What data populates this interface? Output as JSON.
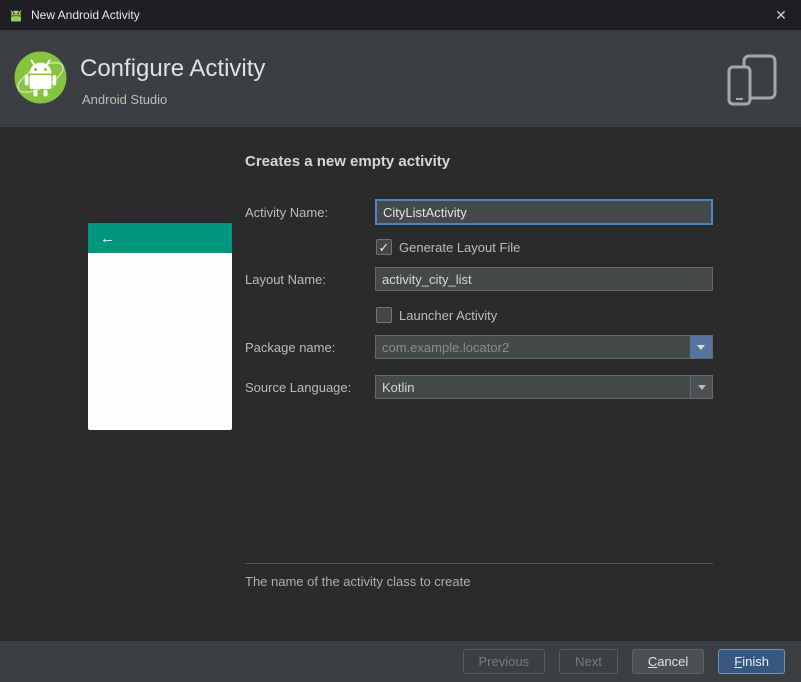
{
  "titlebar": {
    "title": "New Android Activity",
    "close_glyph": "✕"
  },
  "header": {
    "title": "Configure Activity",
    "subtitle": "Android Studio"
  },
  "main": {
    "heading": "Creates a new empty activity",
    "preview": {
      "back_arrow": "←"
    },
    "fields": {
      "activity_name": {
        "label": "Activity Name:",
        "value": "CityListActivity"
      },
      "generate_layout_file": {
        "label": "Generate Layout File",
        "checked": true,
        "check_glyph": "✓"
      },
      "layout_name": {
        "label": "Layout Name:",
        "value": "activity_city_list"
      },
      "launcher_activity": {
        "label": "Launcher Activity",
        "checked": false,
        "check_glyph": ""
      },
      "package_name": {
        "label": "Package name:",
        "value": "com.example.locator2"
      },
      "source_language": {
        "label": "Source Language:",
        "value": "Kotlin"
      }
    },
    "hint": "The name of the activity class to create"
  },
  "footer": {
    "previous": "Previous",
    "next": "Next",
    "cancel": {
      "initial": "C",
      "rest": "ancel"
    },
    "finish": {
      "initial": "F",
      "rest": "inish"
    }
  },
  "colors": {
    "appbar_teal": "#00957e",
    "focus_border_blue": "#4a86c2",
    "finish_button_blue": "#365880",
    "header_gray": "#3c3f41",
    "content_gray": "#2b2b2b"
  }
}
